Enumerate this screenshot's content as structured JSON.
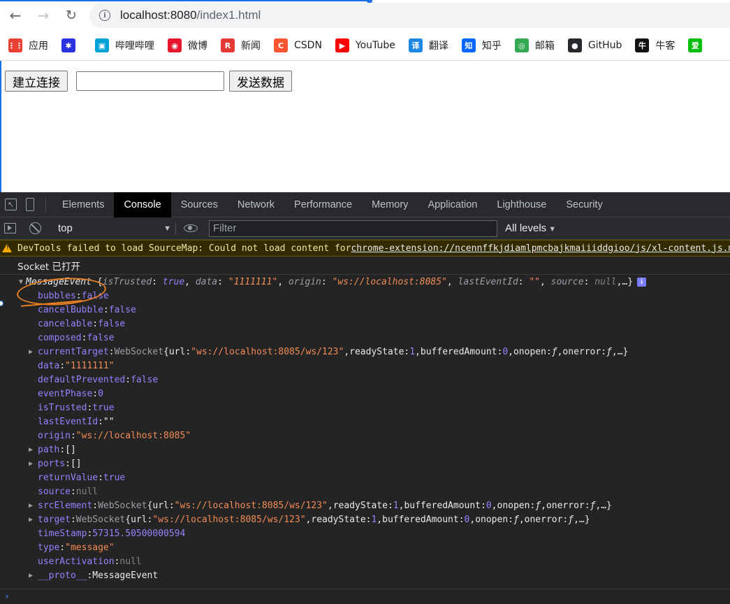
{
  "browser": {
    "url_host": "localhost:8080",
    "url_path": "/index1.html"
  },
  "bookmarks": [
    {
      "icon": "apps-grid-icon",
      "label": "应用",
      "color": "#e94235"
    },
    {
      "icon": "baidu-paw-icon",
      "label": "",
      "color": "#2932e1"
    },
    {
      "icon": "bilibili-tv-icon",
      "label": "哔哩哔哩",
      "color": "#00a1d6"
    },
    {
      "icon": "weibo-icon",
      "label": "微博",
      "color": "#e6162d"
    },
    {
      "icon": "news-r-icon",
      "label": "新闻",
      "color": "#e53935"
    },
    {
      "icon": "csdn-c-icon",
      "label": "CSDN",
      "color": "#fc5531"
    },
    {
      "icon": "youtube-play-icon",
      "label": "YouTube",
      "color": "#ff0000"
    },
    {
      "icon": "translate-icon",
      "label": "翻译",
      "color": "#1e88e5"
    },
    {
      "icon": "zhihu-icon",
      "label": "知乎",
      "color": "#0066ff"
    },
    {
      "icon": "mail-icon",
      "label": "邮箱",
      "color": "#34a853"
    },
    {
      "icon": "github-icon",
      "label": "GitHub",
      "color": "#24292e"
    },
    {
      "icon": "nowcoder-icon",
      "label": "牛客",
      "color": "#111111"
    },
    {
      "icon": "iqiyi-icon",
      "label": "",
      "color": "#00be06"
    }
  ],
  "page": {
    "connect_label": "建立连接",
    "message_value": "",
    "send_label": "发送数据"
  },
  "devtools": {
    "tabs": [
      "Elements",
      "Console",
      "Sources",
      "Network",
      "Performance",
      "Memory",
      "Application",
      "Lighthouse",
      "Security"
    ],
    "active_tab": "Console",
    "context": "top",
    "filter_placeholder": "Filter",
    "levels": "All levels",
    "warning_text": "DevTools failed to load SourceMap: Could not load content for ",
    "warning_link": "chrome-extension://ncennffkjdiamlpmcbajkmaiiiddgioo/js/xl-content.js.map",
    "socket_log": "Socket 已打开",
    "event": {
      "class": "MessageEvent",
      "preview_open": "{",
      "preview": [
        {
          "k": "isTrusted",
          "v": "true",
          "t": "kw"
        },
        {
          "k": "data",
          "v": "\"1111111\"",
          "t": "str"
        },
        {
          "k": "origin",
          "v": "\"ws://localhost:8085\"",
          "t": "str"
        },
        {
          "k": "lastEventId",
          "v": "\"\"",
          "t": "str"
        },
        {
          "k": "source",
          "v": "null",
          "t": "null"
        }
      ],
      "preview_close": "…}",
      "info_badge": "i"
    },
    "properties": [
      {
        "name": "bubbles",
        "value": "false",
        "type": "kw",
        "expandable": false
      },
      {
        "name": "cancelBubble",
        "value": "false",
        "type": "kw",
        "expandable": false
      },
      {
        "name": "cancelable",
        "value": "false",
        "type": "kw",
        "expandable": false
      },
      {
        "name": "composed",
        "value": "false",
        "type": "kw",
        "expandable": false
      },
      {
        "name": "currentTarget",
        "value": "",
        "type": "ws",
        "expandable": true,
        "ws": {
          "url": "\"ws://localhost:8085/ws/123\"",
          "readyState": "1",
          "bufferedAmount": "0",
          "onopen": "ƒ",
          "onerror": "ƒ",
          "more": "…}"
        }
      },
      {
        "name": "data",
        "value": "\"1111111\"",
        "type": "str",
        "expandable": false
      },
      {
        "name": "defaultPrevented",
        "value": "false",
        "type": "kw",
        "expandable": false
      },
      {
        "name": "eventPhase",
        "value": "0",
        "type": "num",
        "expandable": false
      },
      {
        "name": "isTrusted",
        "value": "true",
        "type": "kw",
        "expandable": false
      },
      {
        "name": "lastEventId",
        "value": "\"\"",
        "type": "plain",
        "expandable": false
      },
      {
        "name": "origin",
        "value": "\"ws://localhost:8085\"",
        "type": "str",
        "expandable": false
      },
      {
        "name": "path",
        "value": "[]",
        "type": "plain",
        "expandable": true
      },
      {
        "name": "ports",
        "value": "[]",
        "type": "plain",
        "expandable": true
      },
      {
        "name": "returnValue",
        "value": "true",
        "type": "kw",
        "expandable": false
      },
      {
        "name": "source",
        "value": "null",
        "type": "null",
        "expandable": false
      },
      {
        "name": "srcElement",
        "value": "",
        "type": "ws",
        "expandable": true,
        "ws": {
          "url": "\"ws://localhost:8085/ws/123\"",
          "readyState": "1",
          "bufferedAmount": "0",
          "onopen": "ƒ",
          "onerror": "ƒ",
          "more": "…}"
        }
      },
      {
        "name": "target",
        "value": "",
        "type": "ws",
        "expandable": true,
        "ws": {
          "url": "\"ws://localhost:8085/ws/123\"",
          "readyState": "1",
          "bufferedAmount": "0",
          "onopen": "ƒ",
          "onerror": "ƒ",
          "more": "…}"
        }
      },
      {
        "name": "timeStamp",
        "value": "57315.50500000594",
        "type": "num",
        "expandable": false
      },
      {
        "name": "type",
        "value": "\"message\"",
        "type": "str",
        "expandable": false
      },
      {
        "name": "userActivation",
        "value": "null",
        "type": "null",
        "expandable": false
      },
      {
        "name": "__proto__",
        "value": "MessageEvent",
        "type": "plain",
        "expandable": true
      }
    ],
    "ws_class": "WebSocket",
    "prompt": "›"
  }
}
